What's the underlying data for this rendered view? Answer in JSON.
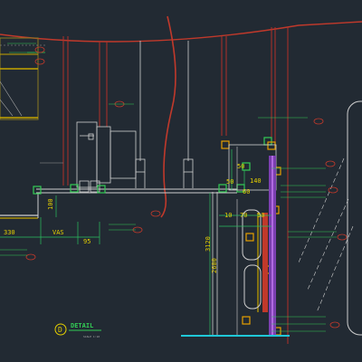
{
  "drawing": {
    "dimensions": {
      "d_330": "330",
      "d_vas": "VAS",
      "d_95": "95",
      "d_100": "100",
      "d_50_a": "50",
      "d_50_b": "50",
      "d_140": "140",
      "d_60": "60",
      "d_70": "70",
      "d_10": "10",
      "d_50_c": "50",
      "d_3120": "3120",
      "d_2600": "2600"
    },
    "detail": {
      "marker": "D",
      "title": "DETAIL",
      "scale": "SCALE 1:10"
    }
  }
}
